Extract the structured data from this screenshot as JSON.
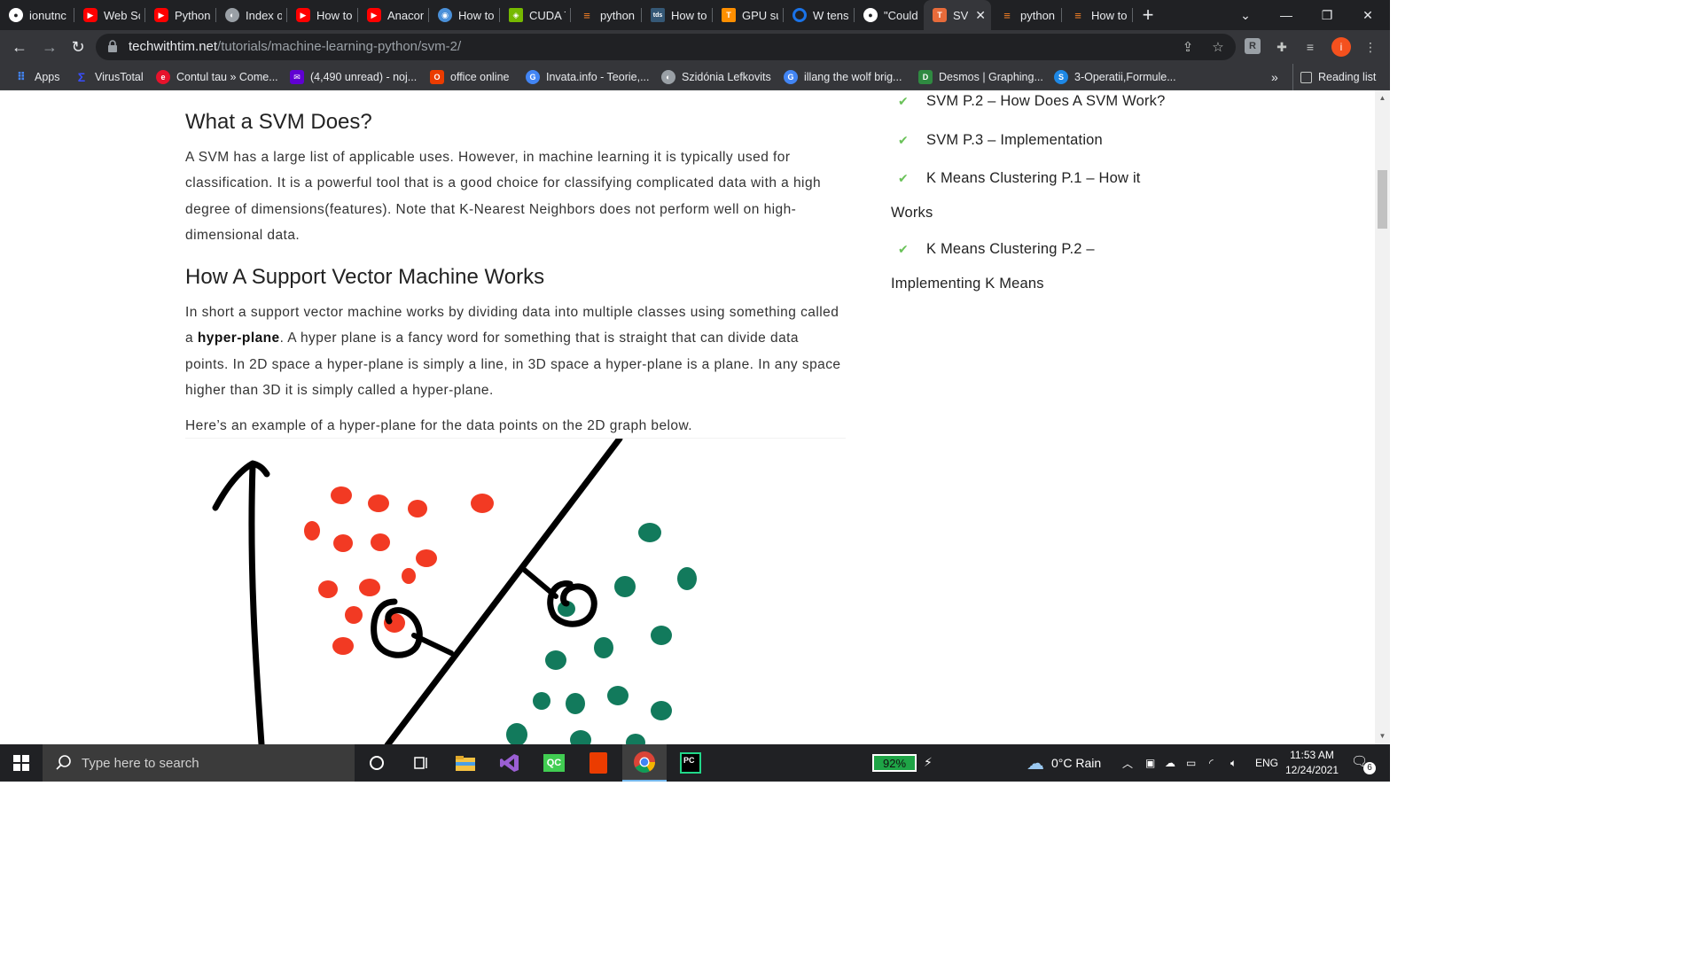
{
  "tabs": [
    {
      "title": "ionutnc",
      "icon": "github-icon",
      "color": "#ffffff"
    },
    {
      "title": "Web Sc",
      "icon": "youtube-icon",
      "color": "#ff0000"
    },
    {
      "title": "Python",
      "icon": "youtube-icon",
      "color": "#ff0000"
    },
    {
      "title": "Index o",
      "icon": "globe-icon",
      "color": "#9aa0a6"
    },
    {
      "title": "How to",
      "icon": "youtube-icon",
      "color": "#ff0000"
    },
    {
      "title": "Anacon",
      "icon": "youtube-icon",
      "color": "#ff0000"
    },
    {
      "title": "How to",
      "icon": "pytorch-icon",
      "color": "#4a90d9"
    },
    {
      "title": "CUDA T",
      "icon": "nvidia-icon",
      "color": "#76b900"
    },
    {
      "title": "python",
      "icon": "stackoverflow-icon",
      "color": "#f48024"
    },
    {
      "title": "How to",
      "icon": "tds-icon",
      "color": "#355876"
    },
    {
      "title": "GPU su",
      "icon": "tensorflow-icon",
      "color": "#ff8f00"
    },
    {
      "title": "W tens",
      "icon": "circle-icon",
      "color": "#1a73e8"
    },
    {
      "title": "\"Could",
      "icon": "github-icon",
      "color": "#ffffff"
    },
    {
      "title": "SVM",
      "icon": "twt-icon",
      "color": "#e86b3a"
    },
    {
      "title": "python",
      "icon": "stackoverflow-icon",
      "color": "#f48024"
    },
    {
      "title": "How to",
      "icon": "stackoverflow-icon",
      "color": "#f48024"
    }
  ],
  "active_tab_index": 13,
  "address": {
    "domain": "techwithtim.net",
    "path": "/tutorials/machine-learning-python/svm-2/"
  },
  "bookmarks": [
    {
      "label": "Apps",
      "icon": "apps-grid-icon",
      "color": "#4285f4"
    },
    {
      "label": "VirusTotal",
      "icon": "virustotal-icon",
      "color": "#394eff"
    },
    {
      "label": "Contul tau » Come...",
      "icon": "emag-icon",
      "color": "#e6132c"
    },
    {
      "label": "(4,490 unread) - noj...",
      "icon": "yahoo-mail-icon",
      "color": "#6001d2"
    },
    {
      "label": "office online",
      "icon": "office-icon",
      "color": "#eb3c00"
    },
    {
      "label": "Invata.info - Teorie,...",
      "icon": "google-icon",
      "color": "#4285f4"
    },
    {
      "label": "Szidónia Lefkovits",
      "icon": "globe-icon",
      "color": "#9aa0a6"
    },
    {
      "label": "illang the wolf brig...",
      "icon": "google-icon",
      "color": "#4285f4"
    },
    {
      "label": "Desmos | Graphing...",
      "icon": "desmos-icon",
      "color": "#2f8a41"
    },
    {
      "label": "3-Operatii,Formule...",
      "icon": "s-icon",
      "color": "#1e88e5"
    }
  ],
  "bookmarks_overflow": "»",
  "reading_list": "Reading list",
  "article": {
    "heading1": "What a SVM Does?",
    "para1": "A SVM has a large list of applicable uses. However, in machine learning it is typically used for classification. It is a powerful tool that is a good choice for classifying complicated data with a high degree of dimensions(features). Note that K-Nearest Neighbors does not perform well on high-dimensional data.",
    "heading2": "How A Support Vector Machine Works",
    "para2_before": "In short a support vector machine works by dividing data into multiple classes using something called a ",
    "para2_bold": "hyper-plane",
    "para2_after": ". A hyper plane is a fancy word for something that is straight that can divide data points. In 2D space a hyper-plane is simply a line, in 3D space a hyper-plane is a plane. In any space higher than 3D it is simply called a hyper-plane.",
    "para3": "Here’s an example of a hyper-plane for the data points on the 2D graph below."
  },
  "sidebar": {
    "item1": "SVM P.2 – How Does A SVM Work?",
    "item2": "SVM P.3 – Implementation",
    "item3_line1": "K Means Clustering P.1 – How it",
    "item3_line2": "Works",
    "item4_line1": "K Means Clustering P.2 –",
    "item4_line2": "Implementing K Means",
    "check_color": "#6ac259"
  },
  "taskbar": {
    "search_placeholder": "Type here to search",
    "battery": "92%",
    "weather": "0°C  Rain",
    "language": "ENG",
    "time": "11:53 AM",
    "date": "12/24/2021",
    "notifications": "6"
  },
  "colors": {
    "red_class": "#f23a23",
    "green_class": "#127a5c",
    "profile_badge": "#f4511e"
  }
}
